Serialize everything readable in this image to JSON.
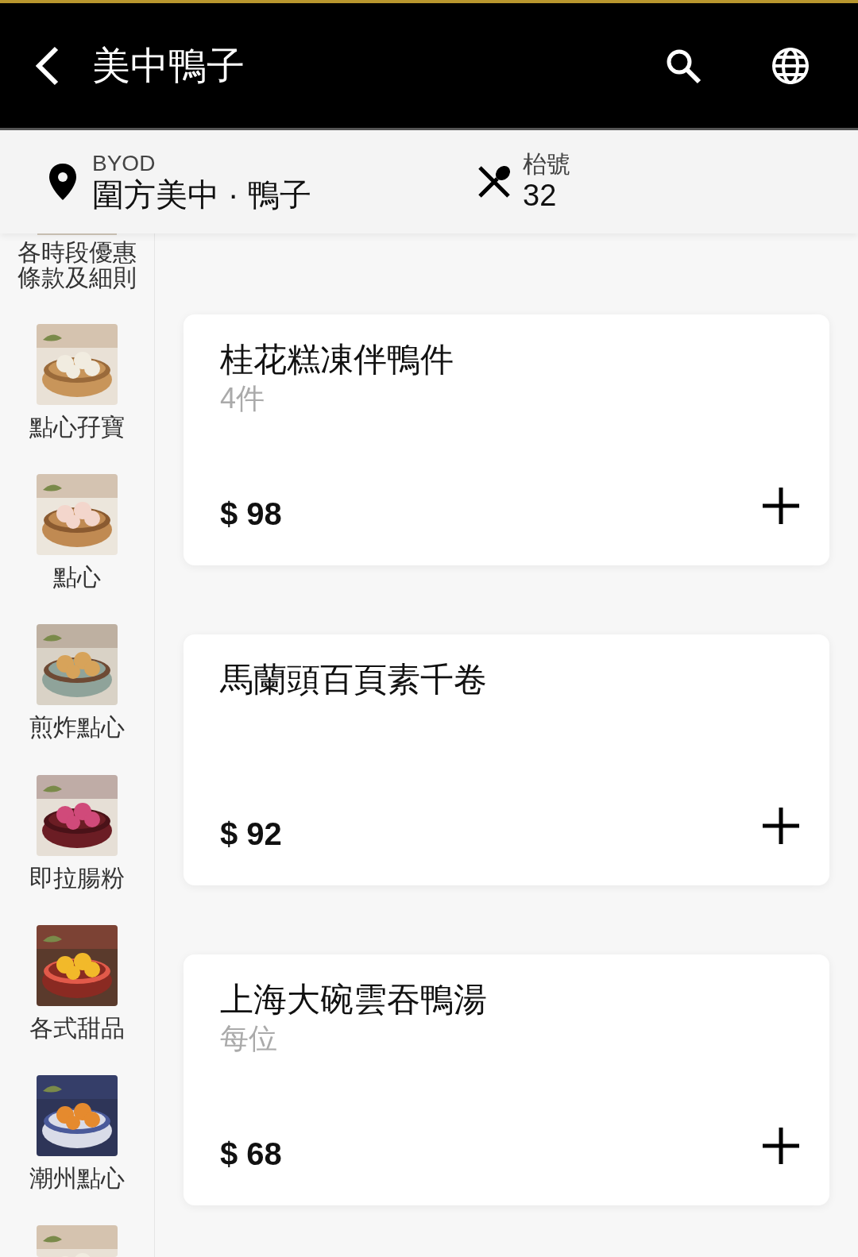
{
  "header": {
    "title": "美中鴨子"
  },
  "info_bar": {
    "location_label": "BYOD",
    "location": "圍方美中 · 鴨子",
    "table_label": "枱號",
    "table_number": "32"
  },
  "sidebar": {
    "items": [
      {
        "kind": "text",
        "label": "各時段優惠條款及細則"
      },
      {
        "label": "點心孖寶"
      },
      {
        "label": "點心"
      },
      {
        "label": "煎炸點心"
      },
      {
        "label": "即拉腸粉"
      },
      {
        "label": "各式甜品"
      },
      {
        "label": "潮州點心"
      },
      {
        "kind": "image_cut"
      }
    ]
  },
  "items": [
    {
      "name": "桂花糕凍伴鴨件",
      "unit": "4件",
      "price": "$ 98"
    },
    {
      "name": "馬蘭頭百頁素千卷",
      "price": "$ 92"
    },
    {
      "name": "上海大碗雲吞鴨湯",
      "unit": "每位",
      "price": "$ 68"
    }
  ]
}
